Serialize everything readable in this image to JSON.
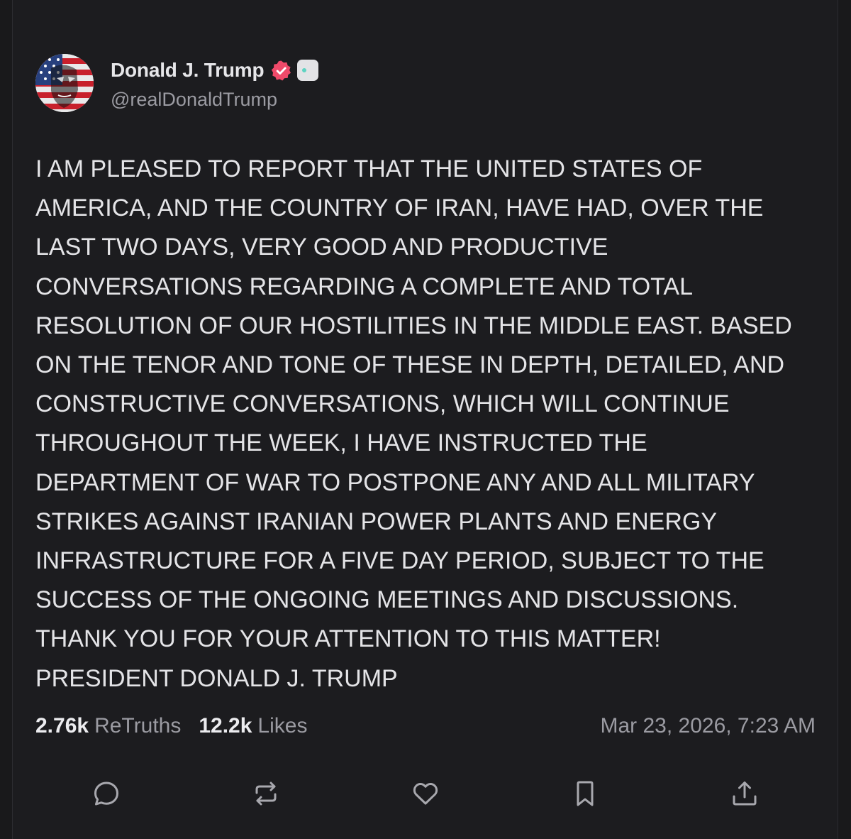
{
  "post": {
    "author": {
      "display_name": "Donald J. Trump",
      "handle": "@realDonaldTrump",
      "verified": true
    },
    "body": "I AM PLEASED TO REPORT THAT THE UNITED STATES OF\nAMERICA, AND THE COUNTRY OF IRAN, HAVE HAD, OVER THE\nLAST TWO DAYS, VERY GOOD AND PRODUCTIVE\nCONVERSATIONS REGARDING A COMPLETE AND TOTAL\nRESOLUTION OF OUR HOSTILITIES IN THE MIDDLE EAST. BASED\nON THE TENOR AND TONE OF THESE IN DEPTH, DETAILED, AND\nCONSTRUCTIVE CONVERSATIONS, WHICH WILL CONTINUE\nTHROUGHOUT THE WEEK, I HAVE INSTRUCTED THE\nDEPARTMENT OF WAR TO POSTPONE ANY AND ALL MILITARY\nSTRIKES AGAINST IRANIAN POWER PLANTS AND ENERGY\nINFRASTRUCTURE FOR A FIVE DAY PERIOD, SUBJECT TO THE\nSUCCESS OF THE ONGOING MEETINGS AND DISCUSSIONS.\nTHANK YOU FOR YOUR ATTENTION TO THIS MATTER!\nPRESIDENT DONALD J. TRUMP",
    "stats": {
      "retruths_count": "2.76k",
      "retruths_label": "ReTruths",
      "likes_count": "12.2k",
      "likes_label": "Likes"
    },
    "timestamp": "Mar 23, 2026, 7:23 AM"
  },
  "actions": [
    {
      "icon": "comment-icon"
    },
    {
      "icon": "retruth-icon"
    },
    {
      "icon": "heart-icon"
    },
    {
      "icon": "bookmark-icon"
    },
    {
      "icon": "share-icon"
    }
  ],
  "colors": {
    "background": "#1c1c1f",
    "text_primary": "#e4e4e7",
    "text_secondary": "#9b9ba2",
    "verified_badge": "#f04a6a"
  }
}
